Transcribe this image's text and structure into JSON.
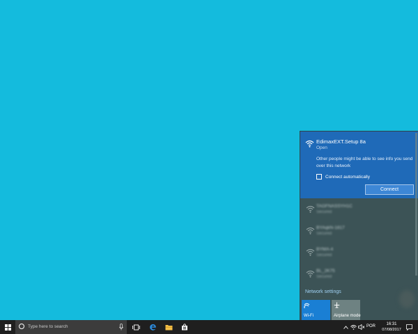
{
  "network": {
    "selected": {
      "ssid": "EdimaxEXT.Setup 8a",
      "state": "Open",
      "warning": "Other people might be able to see info you send over this network",
      "auto_connect_label": "Connect automatically",
      "auto_connect_checked": false,
      "connect_label": "Connect"
    },
    "others": [
      {
        "name": "TAGFNASSYH1C",
        "state": "Secured"
      },
      {
        "name": "BYAqkN-1817",
        "state": "Secured"
      },
      {
        "name": "BYMA-4",
        "state": "Secured"
      },
      {
        "name": "BL_2K75",
        "state": "Secured"
      }
    ],
    "settings_link": "Network settings",
    "tiles": {
      "wifi_label": "Wi-Fi",
      "airplane_label": "Airplane mode"
    }
  },
  "taskbar": {
    "search_placeholder": "Type here to search",
    "language": "POR",
    "time": "16:31",
    "date": "07/08/2017"
  },
  "colors": {
    "desktop": "#14bbdd",
    "selected_network": "#1f6ab8",
    "flyout": "#3c5356",
    "taskbar": "#1f1f1f"
  }
}
